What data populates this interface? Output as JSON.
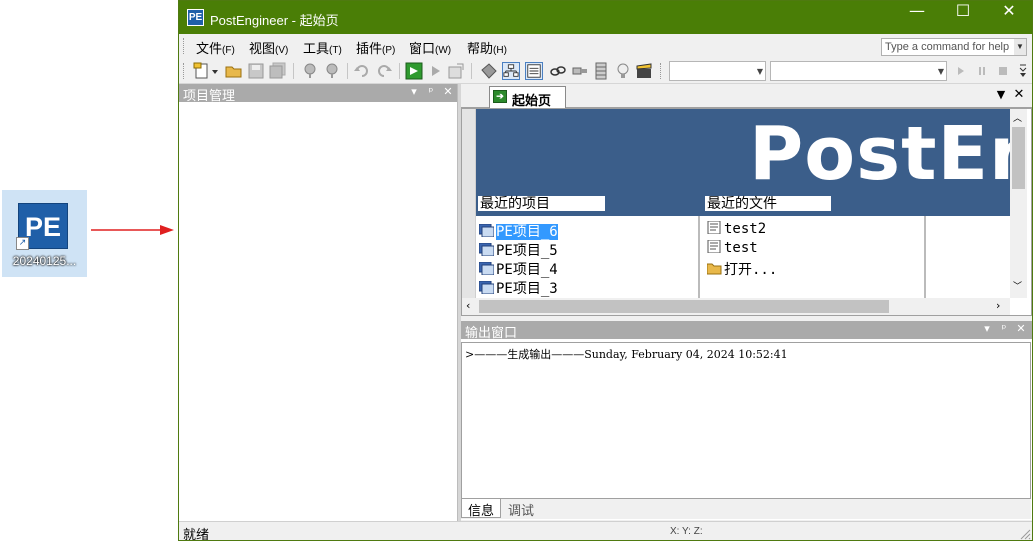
{
  "desktop": {
    "shortcut_icon_text": "PE",
    "shortcut_label": "20240125..."
  },
  "window": {
    "app_icon_text": "PE",
    "title": "PostEngineer - 起始页",
    "minimize_glyph": "—",
    "maximize_glyph": "☐",
    "close_glyph": "✕"
  },
  "menu": {
    "items": [
      {
        "label": "文件",
        "accel": "(F)"
      },
      {
        "label": "视图",
        "accel": "(V)"
      },
      {
        "label": "工具",
        "accel": "(T)"
      },
      {
        "label": "插件",
        "accel": "(P)"
      },
      {
        "label": "窗口",
        "accel": "(W)"
      },
      {
        "label": "帮助",
        "accel": "(H)"
      }
    ],
    "command_placeholder": "Type a command for help"
  },
  "project_pane": {
    "title": "项目管理"
  },
  "document": {
    "tab_label": "起始页",
    "banner_text": "PostEn",
    "recent_projects_header": "最近的项目",
    "recent_files_header": "最近的文件",
    "recent_projects": [
      "PE项目_6",
      "PE项目_5",
      "PE项目_4",
      "PE项目_3"
    ],
    "recent_files": [
      "test2",
      "test"
    ],
    "open_label": "打开..."
  },
  "output_pane": {
    "title": "输出窗口",
    "line": ">———生成输出———Sunday, February 04, 2024 10:52:41",
    "tabs": [
      "信息",
      "调试"
    ]
  },
  "status": {
    "text": "就绪",
    "coords": "X: Y: Z:"
  },
  "colors": {
    "titlebar": "#4a7e06",
    "banner": "#3b5e8a",
    "selection": "#3399ff",
    "pane_header": "#aaaaaa"
  }
}
